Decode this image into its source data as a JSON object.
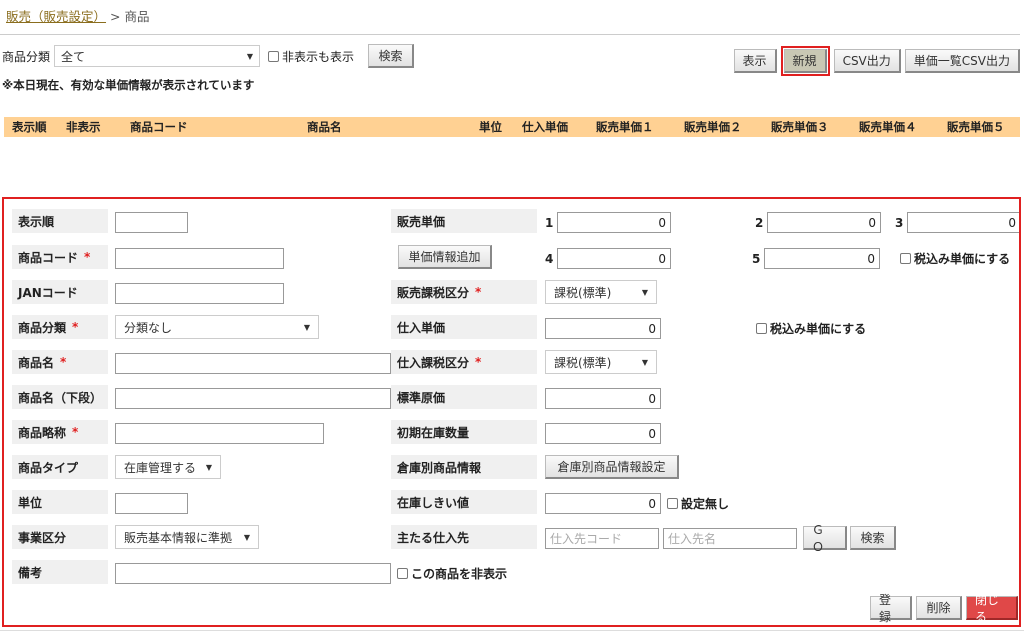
{
  "breadcrumb": {
    "link": "販売（販売設定）",
    "sep": " > ",
    "current": "商品"
  },
  "filter": {
    "label": "商品分類",
    "category_value": "全て",
    "show_hidden_label": "非表示も表示",
    "search_label": "検索"
  },
  "toolbar": {
    "display": "表示",
    "new": "新規",
    "csv": "CSV出力",
    "unit_csv": "単価一覧CSV出力"
  },
  "notice": "※本日現在、有効な単価情報が表示されています",
  "table": {
    "headers": [
      "表示順",
      "非表示",
      "商品コード",
      "商品名",
      "単位",
      "仕入単価",
      "販売単価１",
      "販売単価２",
      "販売単価３",
      "販売単価４",
      "販売単価５"
    ]
  },
  "form": {
    "labels": {
      "order": "表示順",
      "code": "商品コード",
      "jan": "JANコード",
      "category": "商品分類",
      "name": "商品名",
      "name_sub": "商品名（下段）",
      "short": "商品略称",
      "type": "商品タイプ",
      "unit": "単位",
      "division": "事業区分",
      "memo": "備考",
      "sale_price": "販売単価",
      "sale_tax": "販売課税区分",
      "purchase_price": "仕入単価",
      "purchase_tax": "仕入課税区分",
      "std_cost": "標準原価",
      "init_stock": "初期在庫数量",
      "warehouse": "倉庫別商品情報",
      "stock_threshold": "在庫しきい値",
      "supplier": "主たる仕入先"
    },
    "required_mark": "*",
    "values": {
      "category": "分類なし",
      "type": "在庫管理する",
      "division": "販売基本情報に準拠",
      "sale_tax": "課税(標準)",
      "purchase_tax": "課税(標準)",
      "p1": "0",
      "p2": "0",
      "p3": "0",
      "p4": "0",
      "p5": "0",
      "purchase_price": "0",
      "std_cost": "0",
      "init_stock": "0",
      "threshold": "0"
    },
    "price_nums": [
      "1",
      "2",
      "3",
      "4",
      "5"
    ],
    "buttons": {
      "add_price": "単価情報追加",
      "warehouse_setting": "倉庫別商品情報設定",
      "go": "ＧＯ",
      "search": "検索",
      "register": "登録",
      "delete": "削除",
      "close": "閉じる"
    },
    "checks": {
      "tax_in_sale": "税込み単価にする",
      "tax_in_purchase": "税込み単価にする",
      "no_threshold": "設定無し",
      "hide_product": "この商品を非表示"
    },
    "placeholders": {
      "supplier_code": "仕入先コード",
      "supplier_name": "仕入先名"
    }
  }
}
